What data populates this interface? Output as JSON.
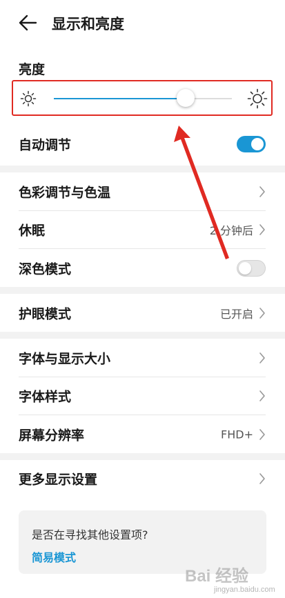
{
  "header": {
    "title": "显示和亮度"
  },
  "brightness": {
    "label": "亮度",
    "level_fraction": 0.74,
    "accent_color": "#1a96d4",
    "highlight_color": "#e02a22"
  },
  "auto_adjust": {
    "label": "自动调节",
    "enabled": true
  },
  "items": {
    "color_temp": {
      "label": "色彩调节与色温"
    },
    "sleep": {
      "label": "休眠",
      "value": "2 分钟后"
    },
    "dark_mode": {
      "label": "深色模式",
      "enabled": false
    },
    "eye_comfort": {
      "label": "护眼模式",
      "value": "已开启"
    },
    "font_size": {
      "label": "字体与显示大小"
    },
    "font_style": {
      "label": "字体样式"
    },
    "resolution": {
      "label": "屏幕分辨率",
      "value": "FHD+"
    },
    "more_display": {
      "label": "更多显示设置"
    }
  },
  "suggestion": {
    "question": "是否在寻找其他设置项?",
    "link": "简易模式"
  },
  "watermark": {
    "main": "Bai 经验",
    "sub": "jingyan.baidu.com"
  },
  "icons": [
    "back-arrow-icon",
    "sun-small-icon",
    "sun-large-icon",
    "chevron-right-icon"
  ]
}
